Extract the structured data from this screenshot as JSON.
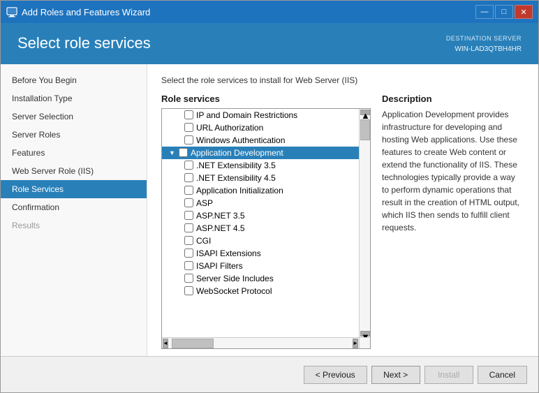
{
  "window": {
    "title": "Add Roles and Features Wizard",
    "icon": "🖥️"
  },
  "title_controls": {
    "minimize": "—",
    "maximize": "□",
    "close": "✕"
  },
  "header": {
    "title": "Select role services",
    "server_label": "DESTINATION SERVER",
    "server_name": "WIN-LAD3QTBH4HR"
  },
  "description_top": "Select the role services to install for Web Server (IIS)",
  "sidebar": {
    "items": [
      {
        "id": "before-you-begin",
        "label": "Before You Begin",
        "state": "normal"
      },
      {
        "id": "installation-type",
        "label": "Installation Type",
        "state": "normal"
      },
      {
        "id": "server-selection",
        "label": "Server Selection",
        "state": "normal"
      },
      {
        "id": "server-roles",
        "label": "Server Roles",
        "state": "normal"
      },
      {
        "id": "features",
        "label": "Features",
        "state": "normal"
      },
      {
        "id": "web-server-role",
        "label": "Web Server Role (IIS)",
        "state": "normal"
      },
      {
        "id": "role-services",
        "label": "Role Services",
        "state": "active"
      },
      {
        "id": "confirmation",
        "label": "Confirmation",
        "state": "normal"
      },
      {
        "id": "results",
        "label": "Results",
        "state": "dimmed"
      }
    ]
  },
  "role_services": {
    "panel_header": "Role services",
    "items": [
      {
        "id": "ip-domain",
        "label": "IP and Domain Restrictions",
        "indent": 2,
        "checked": false,
        "selected": false
      },
      {
        "id": "url-auth",
        "label": "URL Authorization",
        "indent": 2,
        "checked": false,
        "selected": false
      },
      {
        "id": "windows-auth",
        "label": "Windows Authentication",
        "indent": 2,
        "checked": false,
        "selected": false
      },
      {
        "id": "app-dev",
        "label": "Application Development",
        "indent": 1,
        "checked": false,
        "selected": true,
        "expand": true
      },
      {
        "id": "net-ext-35",
        "label": ".NET Extensibility 3.5",
        "indent": 2,
        "checked": false,
        "selected": false
      },
      {
        "id": "net-ext-45",
        "label": ".NET Extensibility 4.5",
        "indent": 2,
        "checked": false,
        "selected": false
      },
      {
        "id": "app-init",
        "label": "Application Initialization",
        "indent": 2,
        "checked": false,
        "selected": false
      },
      {
        "id": "asp",
        "label": "ASP",
        "indent": 2,
        "checked": false,
        "selected": false
      },
      {
        "id": "aspnet-35",
        "label": "ASP.NET 3.5",
        "indent": 2,
        "checked": false,
        "selected": false
      },
      {
        "id": "aspnet-45",
        "label": "ASP.NET 4.5",
        "indent": 2,
        "checked": false,
        "selected": false
      },
      {
        "id": "cgi",
        "label": "CGI",
        "indent": 2,
        "checked": false,
        "selected": false
      },
      {
        "id": "isapi-ext",
        "label": "ISAPI Extensions",
        "indent": 2,
        "checked": false,
        "selected": false
      },
      {
        "id": "isapi-filters",
        "label": "ISAPI Filters",
        "indent": 2,
        "checked": false,
        "selected": false
      },
      {
        "id": "server-side",
        "label": "Server Side Includes",
        "indent": 2,
        "checked": false,
        "selected": false
      },
      {
        "id": "websocket",
        "label": "WebSocket Protocol",
        "indent": 2,
        "checked": false,
        "selected": false
      }
    ]
  },
  "description": {
    "header": "Description",
    "text": "Application Development provides infrastructure for developing and hosting Web applications. Use these features to create Web content or extend the functionality of IIS. These technologies typically provide a way to perform dynamic operations that result in the creation of HTML output, which IIS then sends to fulfill client requests."
  },
  "footer": {
    "prev_label": "< Previous",
    "next_label": "Next >",
    "install_label": "Install",
    "cancel_label": "Cancel"
  }
}
